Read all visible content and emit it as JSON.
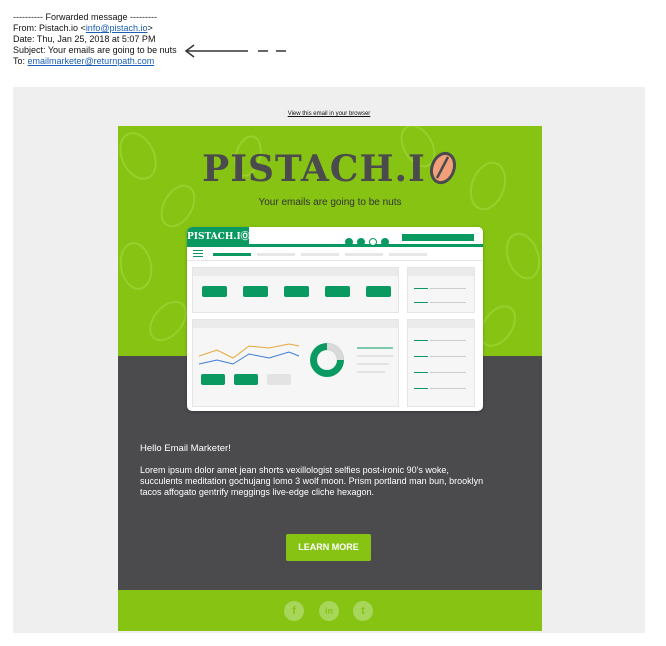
{
  "forward_header": {
    "divider": "---------- Forwarded message ---------",
    "from_label": "From:",
    "from_name": "Pistach.io",
    "from_email": "info@pistach.io",
    "date_label": "Date:",
    "date_value": "Thu, Jan 25, 2018 at 5:07 PM",
    "subject_label": "Subject:",
    "subject_value": "Your emails are going to be nuts",
    "to_label": "To:",
    "to_email": "emailmarketer@returnpath.com"
  },
  "email": {
    "view_in_browser": "View this email in your browser",
    "logo_text": "PISTACH.I",
    "tagline": "Your emails are going to be nuts",
    "mock_logo": "PISTACH.IⓄ",
    "greeting": "Hello Email Marketer!",
    "body_text": "Lorem ipsum dolor amet jean shorts vexillologist selfies post-ironic 90's woke, succulents meditation gochujang lomo 3 wolf moon. Prism portland man bun, brooklyn tacos affogato gentrify meggings live-edge cliche hexagon.",
    "cta_label": "LEARN MORE",
    "social": [
      {
        "icon": "facebook-icon",
        "glyph": "f"
      },
      {
        "icon": "linkedin-icon",
        "glyph": "in"
      },
      {
        "icon": "twitter-icon",
        "glyph": "t"
      }
    ]
  },
  "colors": {
    "brand_green": "#86c313",
    "dark_gray": "#4b4b4e",
    "accent_green": "#0a9960",
    "nut_orange": "#f3a07a"
  }
}
